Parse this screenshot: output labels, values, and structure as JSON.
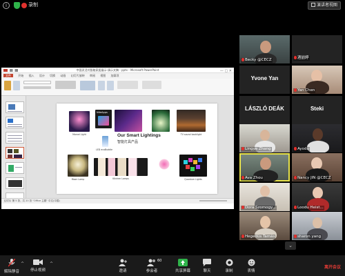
{
  "topbar": {
    "info_icon": "info-icon",
    "shield_icon": "shield-icon",
    "record_label": "录制",
    "gallery_label": "演讲者视图"
  },
  "powerpoint": {
    "window_title": "中国灵活式智能家居展示-演示文稿 - pptx - Microsoft PowerPoint",
    "tabs": [
      "文件",
      "开始",
      "插入",
      "设计",
      "切换",
      "动画",
      "幻灯片放映",
      "审阅",
      "视图",
      "加载项"
    ],
    "status_text": "幻灯片 第 5 张，共 20 张    \"Office 主题\"    中文(中国)",
    "slide": {
      "title": "Our Smart Lightings",
      "subtitle": "智能灯具产品",
      "products": [
        {
          "caption": "Marvel Light"
        },
        {
          "caption": "NiteApps"
        },
        {
          "caption": ""
        },
        {
          "caption": ""
        },
        {
          "caption": "TV sound backlight"
        },
        {
          "caption": "Moon Lamp"
        },
        {
          "caption": "LED ecoBuddie"
        },
        {
          "caption": "Kitchen Lamps"
        },
        {
          "caption": "Quantum Lights"
        }
      ]
    }
  },
  "participants": [
    {
      "name": "Becky @CECZ",
      "type": "video",
      "muted": true
    },
    {
      "name": "酒喆婷",
      "type": "name-only",
      "muted": true
    },
    {
      "name": "Yvone Yan",
      "type": "name-only",
      "muted": false,
      "big": true
    },
    {
      "name": "Yan Chen",
      "type": "video",
      "muted": true
    },
    {
      "name": "LÁSZLÓ DEÁK",
      "type": "name-only",
      "muted": false,
      "big": true
    },
    {
      "name": "Steki",
      "type": "name-only",
      "muted": false,
      "big": true
    },
    {
      "name": "Lingye Zhang",
      "type": "video",
      "muted": true
    },
    {
      "name": "Ayodu",
      "type": "video",
      "muted": true
    },
    {
      "name": "Ava Zhou",
      "type": "video",
      "muted": true,
      "active": true
    },
    {
      "name": "Nancy JIN @CECZ",
      "type": "video",
      "muted": true
    },
    {
      "name": "Dora Szomogy...",
      "type": "video",
      "muted": true
    },
    {
      "name": "Loodu Heist...",
      "type": "video",
      "muted": true
    },
    {
      "name": "Hegedüs Tamás",
      "type": "video",
      "muted": true
    },
    {
      "name": "sharon yang",
      "type": "video",
      "muted": true
    }
  ],
  "toolbar": {
    "unmute_label": "解除静音",
    "stop_video_label": "停止视频",
    "invite_label": "邀请",
    "participants_label": "参会者",
    "participants_count": "60",
    "share_label": "共享屏幕",
    "chat_label": "聊天",
    "record_label": "录制",
    "reactions_label": "表情",
    "end_label": "离开会议"
  },
  "colors": {
    "background": "#000000",
    "accent_green": "#2fb34a",
    "mute_red": "#e0312d",
    "active_speaker": "#e9e34a",
    "end_red": "#e23b35"
  }
}
